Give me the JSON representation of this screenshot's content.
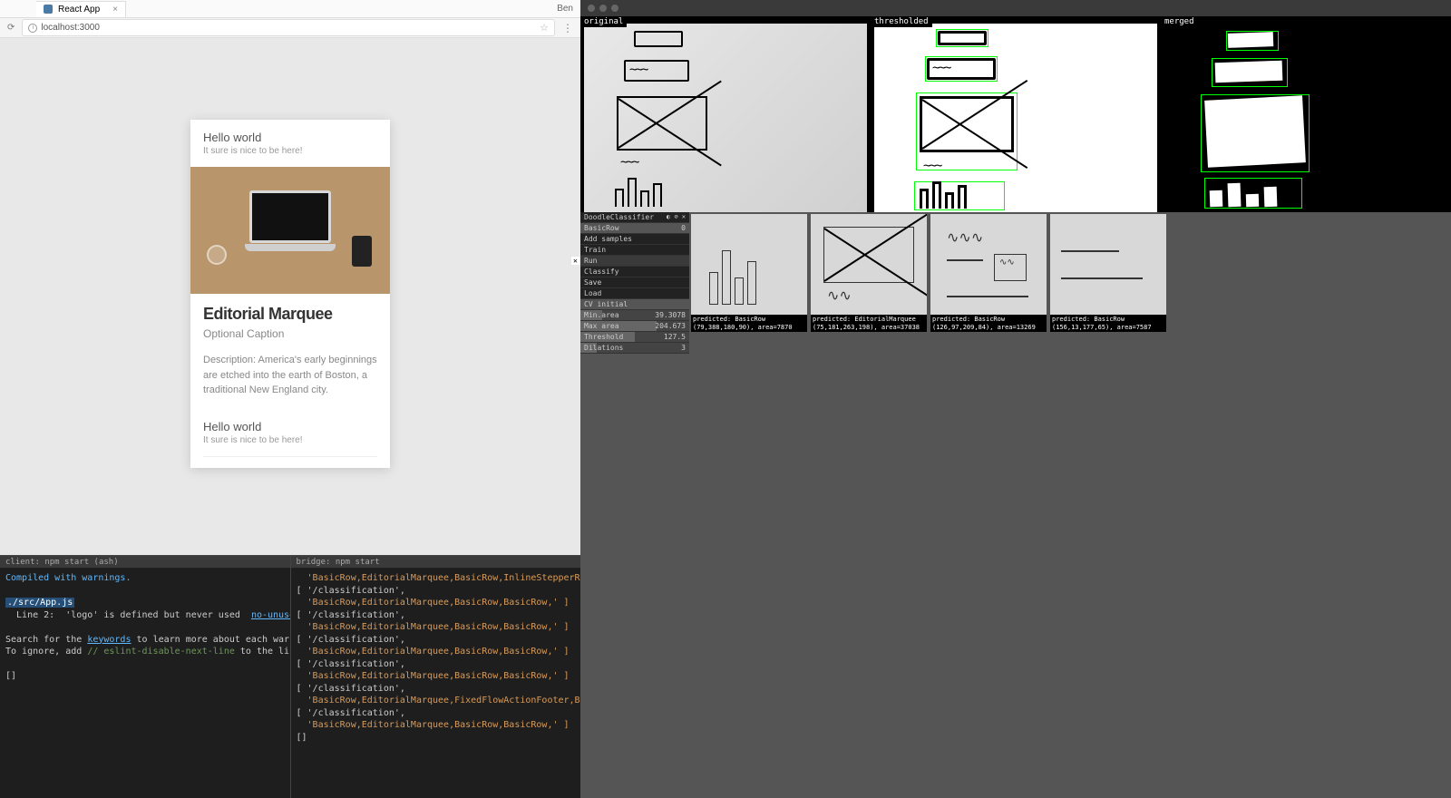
{
  "browser": {
    "tab_title": "React App",
    "user": "Ben",
    "url": "localhost:3000"
  },
  "card": {
    "hello1_title": "Hello world",
    "hello1_sub": "It sure is nice to be here!",
    "marquee_title": "Editorial Marquee",
    "marquee_caption": "Optional Caption",
    "marquee_desc": "Description: America's early beginnings are etched into the earth of Boston, a traditional New England city.",
    "hello2_title": "Hello world",
    "hello2_sub": "It sure is nice to be here!"
  },
  "terminal_left": {
    "tab": "client: npm start (ash)",
    "line1": "Compiled with warnings.",
    "file": "./src/App.js",
    "line2a": "  Line 2:  'logo' is defined but never used  ",
    "line2b": "no-unused-vars",
    "line3a": "Search for the ",
    "line3b": "keywords",
    "line3c": " to learn more about each warning.",
    "line4a": "To ignore, add ",
    "line4b": "// eslint-disable-next-line",
    "line4c": " to the line before.",
    "prompt": "[]"
  },
  "terminal_right": {
    "tab": "bridge: npm start",
    "lines": [
      "  'BasicRow,EditorialMarquee,BasicRow,InlineStepperRow,' ]",
      "[ '/classification',",
      "  'BasicRow,EditorialMarquee,BasicRow,BasicRow,' ]",
      "[ '/classification',",
      "  'BasicRow,EditorialMarquee,BasicRow,BasicRow,' ]",
      "[ '/classification',",
      "  'BasicRow,EditorialMarquee,BasicRow,BasicRow,' ]",
      "[ '/classification',",
      "  'BasicRow,EditorialMarquee,BasicRow,BasicRow,' ]",
      "[ '/classification',",
      "  'BasicRow,EditorialMarquee,FixedFlowActionFooter,BasicRow,' ]",
      "[ '/classification',",
      "  'BasicRow,EditorialMarquee,BasicRow,BasicRow,' ]",
      "[]"
    ]
  },
  "cv": {
    "views": [
      "original",
      "thresholded",
      "merged"
    ],
    "panel_title": "DoodleClassifier",
    "class_label": "BasicRow",
    "class_count": "0",
    "actions": [
      "Add samples",
      "Train",
      "Run",
      "Classify",
      "Save",
      "Load"
    ],
    "cv_section": "CV initial",
    "params": [
      {
        "name": "Min.area",
        "val": "39.3078"
      },
      {
        "name": "Max area",
        "val": "204.673"
      },
      {
        "name": "Threshold",
        "val": "127.5"
      },
      {
        "name": "Dilations",
        "val": "3"
      }
    ],
    "samples": [
      {
        "pred": "predicted: BasicRow",
        "coords": "(79,388,180,90), area=7870"
      },
      {
        "pred": "predicted: EditorialMarquee",
        "coords": "(75,181,263,198), area=37038"
      },
      {
        "pred": "predicted: BasicRow",
        "coords": "(126,97,209,84), area=13269"
      },
      {
        "pred": "predicted: BasicRow",
        "coords": "(156,13,177,65), area=7587"
      }
    ]
  }
}
